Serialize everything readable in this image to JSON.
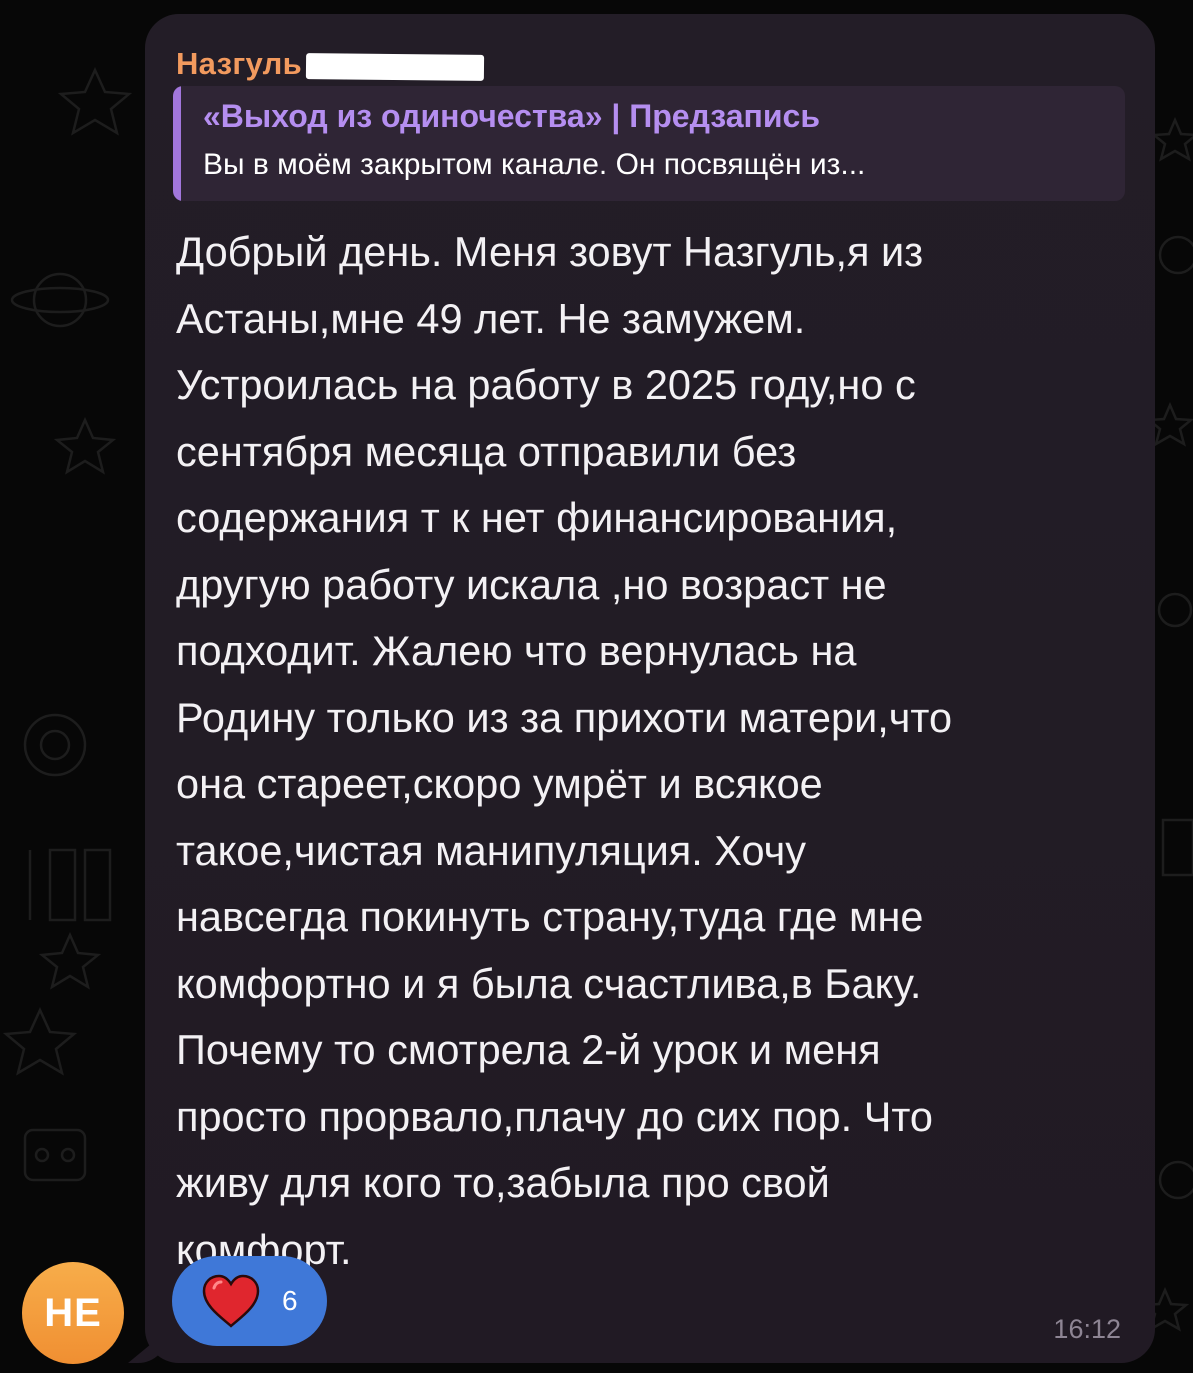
{
  "chat": {
    "avatar_initials": "НЕ",
    "message": {
      "sender_name": "Назгуль",
      "reply": {
        "title": "«Выход из одиночества» | Предзапись",
        "text": "Вы в моём закрытом канале. Он посвящён из..."
      },
      "text_lines": [
        "Добрый день. Меня зовут Назгуль,я из",
        "Астаны,мне 49 лет. Не замужем.",
        "Устроилась на работу в 2025 году,но с",
        "сентября месяца отправили без",
        "содержания т к нет финансирования,",
        "другую работу искала ,но возраст не",
        "подходит. Жалею что вернулась на",
        "Родину только из за прихоти матери,что",
        "она стареет,скоро умрёт и всякое",
        "такое,чистая манипуляция. Хочу",
        "навсегда покинуть страну,туда где мне",
        "комфортно и я была счастлива,в Баку.",
        "Почему то смотрела 2-й урок и меня",
        "просто прорвало,плачу до сих пор. Что",
        "живу для кого то,забыла про свой",
        "комфорт."
      ],
      "reaction": {
        "icon": "heart-icon",
        "count": "6"
      },
      "time": "16:12"
    }
  },
  "colors": {
    "background": "#070707",
    "bubble": "#231d27",
    "sender_name": "#f29a5e",
    "reply_bar": "#a277dc",
    "reply_title": "#b58ef0",
    "reaction": "#3f78d8",
    "heart": "#e0262e",
    "avatar": "#f29a3a"
  }
}
